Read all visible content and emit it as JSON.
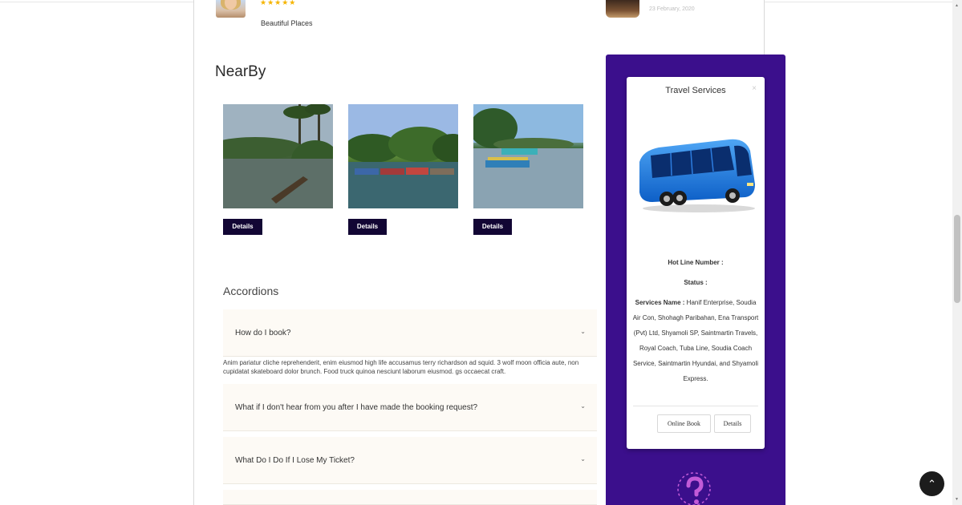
{
  "review": {
    "stars": "★★★★★",
    "text": "Beautiful Places"
  },
  "recent_post": {
    "date": "23 February, 2020"
  },
  "nearby": {
    "title": "NearBy",
    "cards": [
      {
        "button_label": "Details"
      },
      {
        "button_label": "Details"
      },
      {
        "button_label": "Details"
      }
    ]
  },
  "accordions": {
    "title": "Accordions",
    "items": [
      {
        "question": "How do I book?",
        "expanded": true,
        "answer": "Anim pariatur cliche reprehenderit, enim eiusmod high life accusamus terry richardson ad squid. 3 wolf moon officia aute, non cupidatat skateboard dolor brunch. Food truck quinoa nesciunt laborum eiusmod. gs occaecat craft."
      },
      {
        "question": "What if I don't hear from you after I have made the booking request?",
        "expanded": false
      },
      {
        "question": "What Do I Do If I Lose My Ticket?",
        "expanded": false
      }
    ],
    "chevron": "⌄"
  },
  "travel_popup": {
    "title": "Travel Services",
    "close": "×",
    "hotline_label": "Hot Line Number :",
    "status_label": "Status :",
    "services_label": "Services Name :",
    "services_value": "Hanif Enterprise, Soudia Air Con, Shohagh Paribahan, Ena Transport (Pvt) Ltd, Shyamoli SP, Saintmartin Travels, Royal Coach, Tuba Line, Soudia Coach Service, Saintmartin Hyundai, and Shyamoli Express.",
    "online_book_label": "Online Book",
    "details_label": "Details"
  },
  "colors": {
    "sidebar": "#3b0f8c",
    "button_dark": "#120634",
    "accent_pink": "#c25bd8"
  },
  "back_to_top": "⌃"
}
